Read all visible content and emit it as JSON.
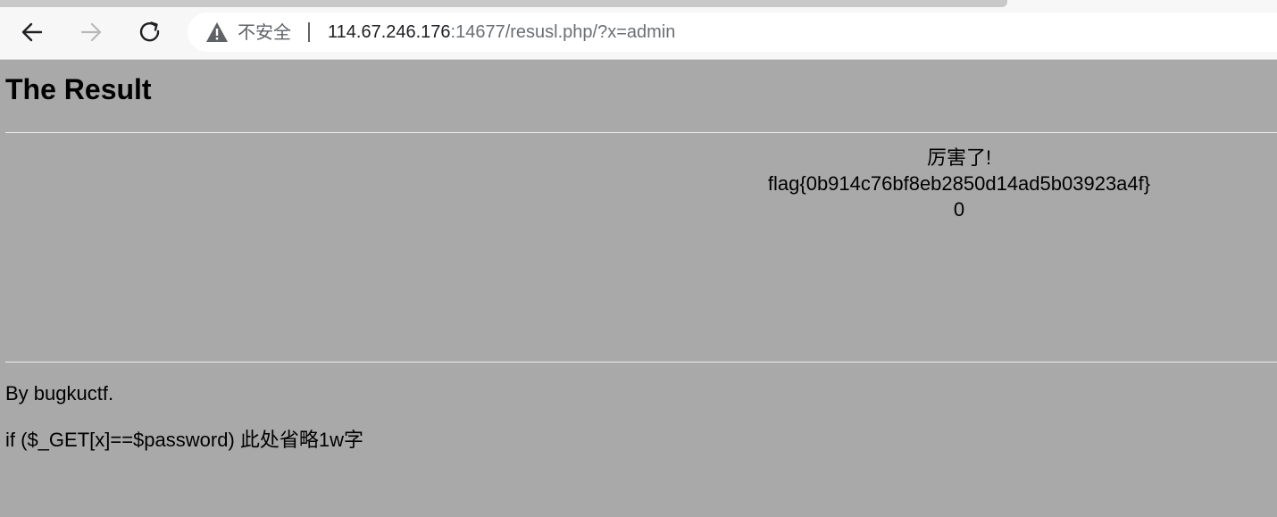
{
  "browser": {
    "security_label": "不安全",
    "url_host": "114.67.246.176",
    "url_rest": ":14677/resusl.php/?x=admin",
    "icons": {
      "back": "arrow-left-icon",
      "forward": "arrow-right-icon",
      "reload": "reload-icon",
      "warning": "warning-triangle-icon"
    }
  },
  "page": {
    "title": "The Result",
    "result": {
      "message": "厉害了!",
      "flag": "flag{0b914c76bf8eb2850d14ad5b03923a4f}",
      "number": "0"
    },
    "footer": {
      "byline": "By bugkuctf.",
      "hint": "if ($_GET[x]==$password) 此处省略1w字"
    }
  },
  "colors": {
    "page_background": "#a9a9a9",
    "toolbar_background": "#f7f7f7"
  }
}
